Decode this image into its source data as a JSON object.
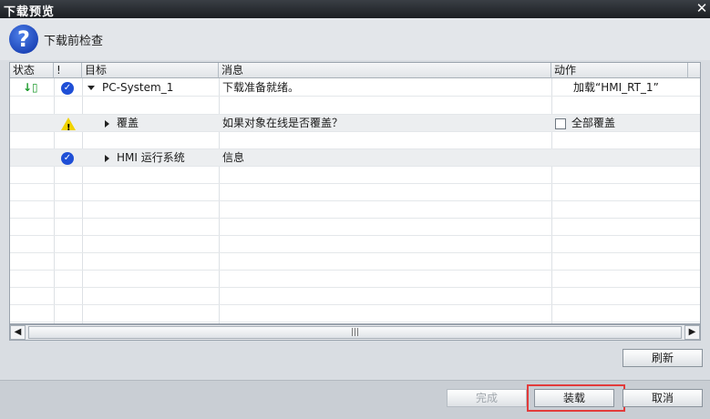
{
  "window": {
    "title": "下载预览",
    "close_glyph": "✕"
  },
  "header": {
    "icon": "question-icon",
    "text": "下载前检查"
  },
  "columns": {
    "status": "状态",
    "alert": "!",
    "target": "目标",
    "message": "消息",
    "action": "动作"
  },
  "rows": [
    {
      "target": "PC-System_1",
      "message": "下载准备就绪。",
      "action": "加载“HMI_RT_1”",
      "status_icon": "download-status-icon",
      "alert_icon": "check-warning-icon"
    },
    {
      "target": "覆盖",
      "message": "如果对象在线是否覆盖？",
      "action": "全部覆盖",
      "alert_icon": "warning-icon"
    },
    {
      "target": "HMI 运行系统",
      "message": "信息",
      "action": "",
      "alert_icon": "check-icon"
    }
  ],
  "scrollbar": {
    "thumb_grip": "|||"
  },
  "buttons": {
    "refresh": "刷新",
    "finish": "完成",
    "load": "装载",
    "cancel": "取消"
  },
  "colors": {
    "accent_blue": "#1f4fd6",
    "warning_yellow": "#f1d300",
    "highlight_red": "#e23b3b"
  }
}
